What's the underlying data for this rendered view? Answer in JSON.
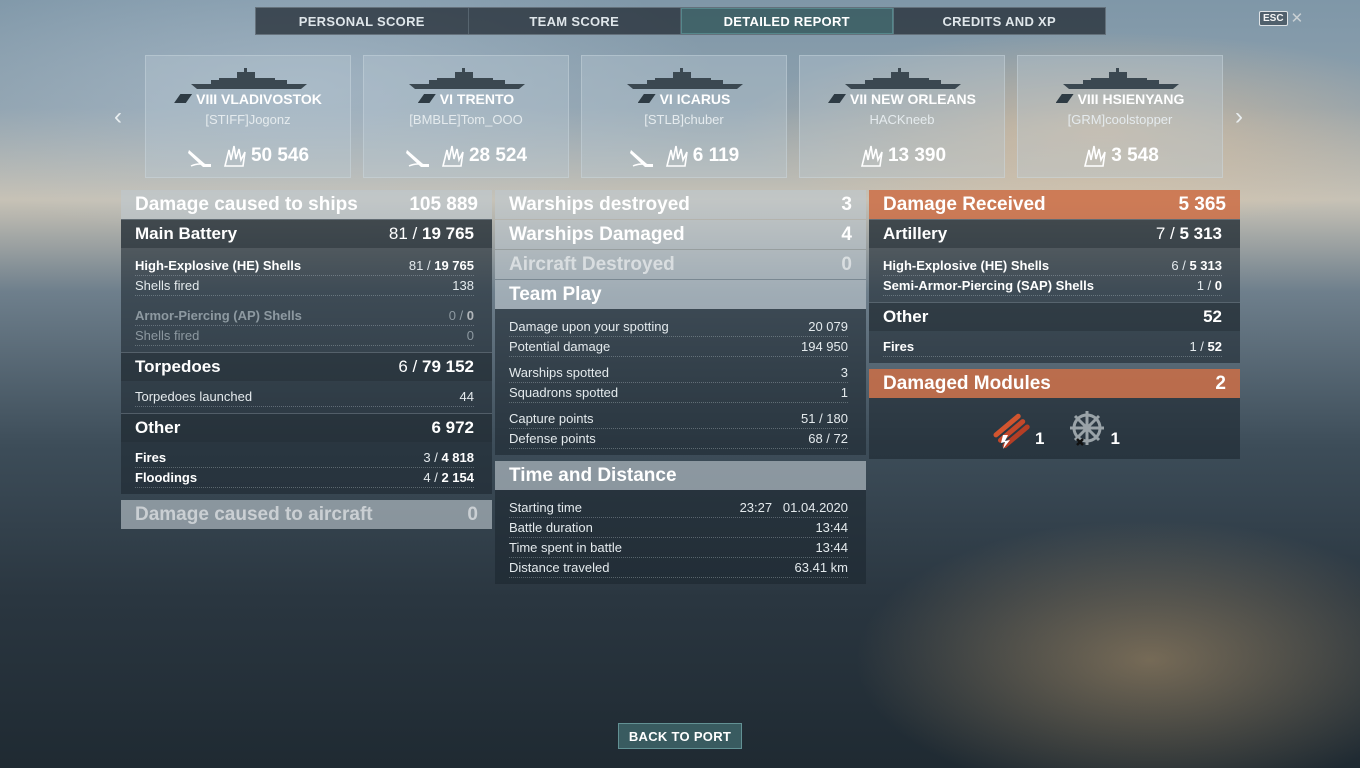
{
  "tabs": [
    "PERSONAL SCORE",
    "TEAM SCORE",
    "DETAILED REPORT",
    "CREDITS AND XP"
  ],
  "active_tab": "DETAILED REPORT",
  "esc": {
    "key": "ESC",
    "close": "✕"
  },
  "nav": {
    "prev": "‹",
    "next": "›"
  },
  "ships": [
    {
      "name": "VIII VLADIVOSTOK",
      "player": "[STIFF]Jogonz",
      "damage": "50 546",
      "sunk_icon": true
    },
    {
      "name": "VI TRENTO",
      "player": "[BMBLE]Tom_OOO",
      "damage": "28 524",
      "sunk_icon": true
    },
    {
      "name": "VI ICARUS",
      "player": "[STLB]chuber",
      "damage": "6 119",
      "sunk_icon": true
    },
    {
      "name": "VII NEW ORLEANS",
      "player": "HACKneeb",
      "damage": "13 390",
      "sunk_icon": false
    },
    {
      "name": "VIII HSIENYANG",
      "player": "[GRM]coolstopper",
      "damage": "3 548",
      "sunk_icon": false
    }
  ],
  "damage_ships": {
    "title": "Damage caused to ships",
    "value": "105 889",
    "main_battery": {
      "label": "Main Battery",
      "hits": "81",
      "damage": "19 765"
    },
    "he": {
      "label": "High-Explosive (HE) Shells",
      "hits": "81",
      "damage": "19 765"
    },
    "he_fired": {
      "label": "Shells fired",
      "value": "138"
    },
    "ap": {
      "label": "Armor-Piercing (AP) Shells",
      "hits": "0",
      "damage": "0"
    },
    "ap_fired": {
      "label": "Shells fired",
      "value": "0"
    },
    "torpedoes": {
      "label": "Torpedoes",
      "hits": "6",
      "damage": "79 152"
    },
    "torp_launched": {
      "label": "Torpedoes launched",
      "value": "44"
    },
    "other": {
      "label": "Other",
      "value": "6 972"
    },
    "fires": {
      "label": "Fires",
      "hits": "3",
      "damage": "4 818"
    },
    "floodings": {
      "label": "Floodings",
      "hits": "4",
      "damage": "2 154"
    }
  },
  "damage_aircraft": {
    "title": "Damage caused to aircraft",
    "value": "0"
  },
  "middle": {
    "destroyed": {
      "label": "Warships destroyed",
      "value": "3"
    },
    "damaged": {
      "label": "Warships Damaged",
      "value": "4"
    },
    "aircraft": {
      "label": "Aircraft Destroyed",
      "value": "0"
    },
    "team_play": {
      "title": "Team Play",
      "spotting": {
        "label": "Damage upon your spotting",
        "value": "20 079"
      },
      "potential": {
        "label": "Potential damage",
        "value": "194 950"
      },
      "warships_spotted": {
        "label": "Warships spotted",
        "value": "3"
      },
      "squadrons_spotted": {
        "label": "Squadrons spotted",
        "value": "1"
      },
      "capture": {
        "label": "Capture points",
        "value": "51 / 180"
      },
      "defense": {
        "label": "Defense points",
        "value": "68 / 72"
      }
    },
    "time": {
      "title": "Time and Distance",
      "start": {
        "label": "Starting time",
        "value": "23:27   01.04.2020"
      },
      "duration": {
        "label": "Battle duration",
        "value": "13:44"
      },
      "spent": {
        "label": "Time spent in battle",
        "value": "13:44"
      },
      "distance": {
        "label": "Distance traveled",
        "value": "63.41 km"
      }
    }
  },
  "received": {
    "title": "Damage Received",
    "value": "5 365",
    "artillery": {
      "label": "Artillery",
      "hits": "7",
      "damage": "5 313"
    },
    "he": {
      "label": "High-Explosive (HE) Shells",
      "hits": "6",
      "damage": "5 313"
    },
    "sap": {
      "label": "Semi-Armor-Piercing (SAP) Shells",
      "hits": "1",
      "damage": "0"
    },
    "other": {
      "label": "Other",
      "value": "52"
    },
    "fires": {
      "label": "Fires",
      "hits": "1",
      "damage": "52"
    },
    "modules": {
      "title": "Damaged Modules",
      "value": "2",
      "items": [
        {
          "icon": "torpedo-tubes-damaged-icon",
          "count": "1"
        },
        {
          "icon": "steering-gear-damaged-icon",
          "count": "1"
        }
      ]
    }
  },
  "back_button": "BACK TO PORT",
  "colors": {
    "accent_teal": "#466e73",
    "damage_received": "#cd6e46"
  }
}
